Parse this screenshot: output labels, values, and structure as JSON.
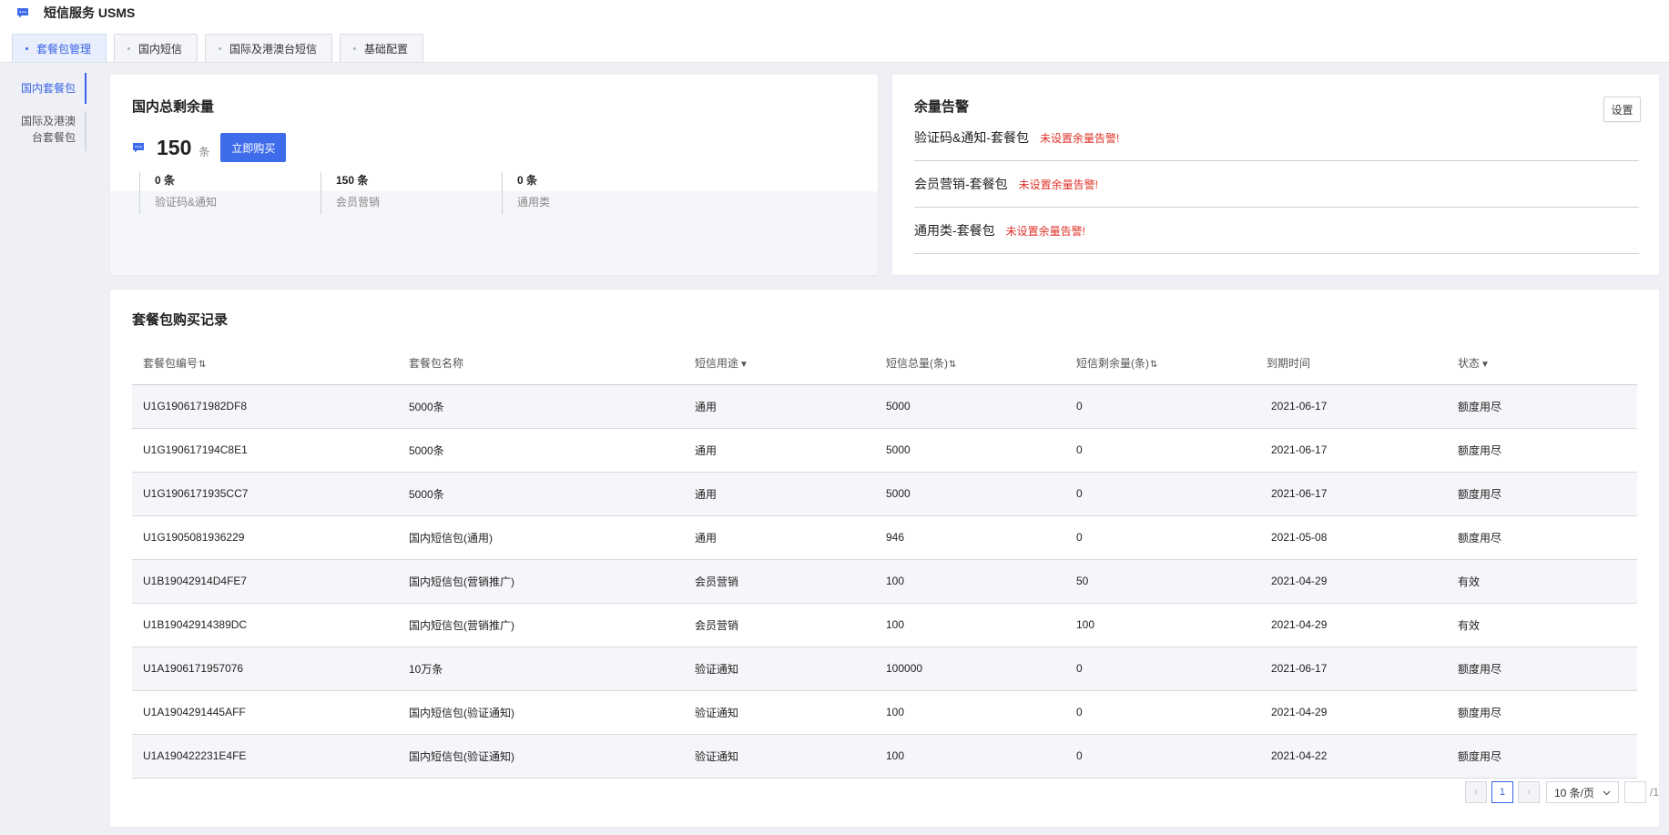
{
  "app": {
    "title": "短信服务 USMS"
  },
  "tabs": [
    {
      "label": "套餐包管理",
      "active": true
    },
    {
      "label": "国内短信",
      "active": false
    },
    {
      "label": "国际及港澳台短信",
      "active": false
    },
    {
      "label": "基础配置",
      "active": false
    }
  ],
  "sidenav": {
    "items": [
      {
        "label": "国内套餐包",
        "active": true
      },
      {
        "label": "国际及港澳台套餐包",
        "line1": "国际及港澳",
        "line2": "台套餐包",
        "active": false
      }
    ]
  },
  "quota": {
    "title": "国内总剩余量",
    "total": "150",
    "unit": "条",
    "buy_label": "立即购买",
    "items": [
      {
        "value": "0 条",
        "label": "验证码&通知"
      },
      {
        "value": "150 条",
        "label": "会员营销"
      },
      {
        "value": "0 条",
        "label": "通用类"
      }
    ]
  },
  "alert": {
    "title": "余量告警",
    "set_label": "设置",
    "rows": [
      {
        "name": "验证码&通知-套餐包",
        "warn": "未设置余量告警!"
      },
      {
        "name": "会员营销-套餐包",
        "warn": "未设置余量告警!"
      },
      {
        "name": "通用类-套餐包",
        "warn": "未设置余量告警!"
      }
    ]
  },
  "records": {
    "title": "套餐包购买记录",
    "columns": [
      {
        "label": "套餐包编号",
        "icon": "sort-icon"
      },
      {
        "label": "套餐包名称",
        "icon": ""
      },
      {
        "label": "短信用途",
        "icon": "filter-icon"
      },
      {
        "label": "短信总量(条)",
        "icon": "sort-icon"
      },
      {
        "label": "短信剩余量(条)",
        "icon": "sort-icon"
      },
      {
        "label": "到期时间",
        "icon": ""
      },
      {
        "label": "状态",
        "icon": "filter-icon"
      }
    ],
    "rows": [
      [
        "U1G1906171982DF8",
        "5000条",
        "通用",
        "5000",
        "0",
        "2021-06-17",
        "额度用尽"
      ],
      [
        "U1G190617194C8E1",
        "5000条",
        "通用",
        "5000",
        "0",
        "2021-06-17",
        "额度用尽"
      ],
      [
        "U1G1906171935CC7",
        "5000条",
        "通用",
        "5000",
        "0",
        "2021-06-17",
        "额度用尽"
      ],
      [
        "U1G1905081936229",
        "国内短信包(通用)",
        "通用",
        "946",
        "0",
        "2021-05-08",
        "额度用尽"
      ],
      [
        "U1B19042914D4FE7",
        "国内短信包(营销推广)",
        "会员营销",
        "100",
        "50",
        "2021-04-29",
        "有效"
      ],
      [
        "U1B19042914389DC",
        "国内短信包(营销推广)",
        "会员营销",
        "100",
        "100",
        "2021-04-29",
        "有效"
      ],
      [
        "U1A1906171957076",
        "10万条",
        "验证通知",
        "100000",
        "0",
        "2021-06-17",
        "额度用尽"
      ],
      [
        "U1A1904291445AFF",
        "国内短信包(验证通知)",
        "验证通知",
        "100",
        "0",
        "2021-04-29",
        "额度用尽"
      ],
      [
        "U1A190422231E4FE",
        "国内短信包(验证通知)",
        "验证通知",
        "100",
        "0",
        "2021-04-22",
        "额度用尽"
      ]
    ]
  },
  "pagination": {
    "prev": "‹",
    "current": "1",
    "next": "›",
    "page_size": "10 条/页",
    "total_pages": "/1"
  },
  "colors": {
    "accent": "#3f6ceb",
    "warn": "#e0322a",
    "bg": "#eef0f5"
  }
}
